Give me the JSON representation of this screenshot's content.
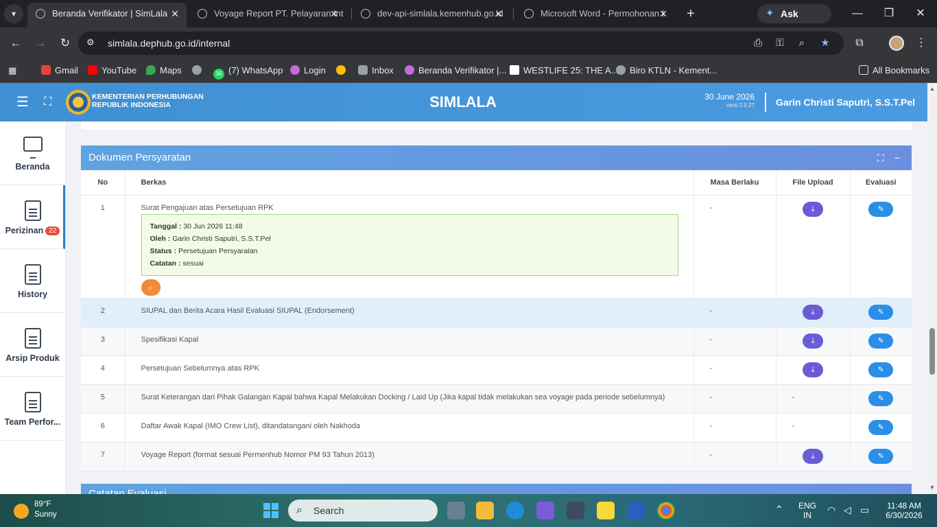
{
  "browser": {
    "tabs": [
      {
        "title": "Beranda Verifikator | SimLala",
        "active": true
      },
      {
        "title": "Voyage Report PT. Pelayaran Int",
        "active": false
      },
      {
        "title": "dev-api-simlala.kemenhub.go.id",
        "active": false
      },
      {
        "title": "Microsoft Word - Permohonan I",
        "active": false
      }
    ],
    "gemini_label": "Ask Gemini",
    "url": "simlala.dephub.go.id/internal",
    "bookmarks": [
      {
        "label": "Gmail",
        "color": "#ea4335"
      },
      {
        "label": "YouTube",
        "color": "#ff0000"
      },
      {
        "label": "Maps",
        "color": "#34a853"
      },
      {
        "label": "",
        "color": "#9aa0a6"
      },
      {
        "label": "(7) WhatsApp",
        "color": "#25d366"
      },
      {
        "label": "Login",
        "color": "#c26bd6"
      },
      {
        "label": "",
        "color": "#fbbc04"
      },
      {
        "label": "Inbox",
        "color": "#9aa0a6"
      },
      {
        "label": "Beranda Verifikator |...",
        "color": "#c26bd6"
      },
      {
        "label": "WESTLIFE 25: THE A...",
        "color": "#ffffff"
      },
      {
        "label": "Biro KTLN - Kement...",
        "color": "#9aa0a6"
      }
    ],
    "whatsapp_count": "36",
    "all_bookmarks": "All Bookmarks"
  },
  "header": {
    "org_line1": "KEMENTERIAN PERHUBUNGAN",
    "org_line2": "REPUBLIK INDONESIA",
    "app_name": "SIMLALA",
    "date": "30 June 2026",
    "version": "versi 2.0.27",
    "user": "Garin Christi Saputri, S.S.T.Pel"
  },
  "sidebar": {
    "items": [
      {
        "label": "Beranda"
      },
      {
        "label": "Perizinan",
        "badge": "22"
      },
      {
        "label": "History"
      },
      {
        "label": "Arsip Produk"
      },
      {
        "label": "Team Perfor..."
      }
    ]
  },
  "documents": {
    "title": "Dokumen Persyaratan",
    "columns": [
      "No",
      "Berkas",
      "Masa Berlaku",
      "File Upload",
      "Evaluasi"
    ],
    "rows": [
      {
        "no": "1",
        "berkas": "Surat Pengajuan atas Persetujuan RPK",
        "masa": "-",
        "has_upload": true
      },
      {
        "no": "2",
        "berkas": "SIUPAL dan Berita Acara Hasil Evaluasi SIUPAL (Endorsement)",
        "masa": "-",
        "has_upload": true
      },
      {
        "no": "3",
        "berkas": "Spesifikasi Kapal",
        "masa": "-",
        "has_upload": true
      },
      {
        "no": "4",
        "berkas": "Persetujuan Sebelumnya atas RPK",
        "masa": "-",
        "has_upload": true
      },
      {
        "no": "5",
        "berkas": "Surat Keterangan dari Pihak Galangan Kapal bahwa Kapal Melakukan Docking / Laid Up (Jika kapal tidak melakukan sea voyage pada periode sebelumnya)",
        "masa": "-",
        "has_upload": false,
        "upload_text": "-"
      },
      {
        "no": "6",
        "berkas": "Daftar Awak Kapal (IMO Crew List), ditandatangani oleh Nakhoda",
        "masa": "-",
        "has_upload": false,
        "upload_text": "-"
      },
      {
        "no": "7",
        "berkas": "Voyage Report (format sesuai Permenhub Nomor PM 93 Tahun 2013)",
        "masa": "-",
        "has_upload": true
      }
    ],
    "evaluation": {
      "tanggal_label": "Tanggal :",
      "tanggal": "30 Jun 2026 11:48",
      "oleh_label": "Oleh :",
      "oleh": "Garin Christi Saputri, S.S.T.Pel",
      "status_label": "Status :",
      "status": "Persetujuan Persyaratan",
      "catatan_label": "Catatan :",
      "catatan": "sesuai"
    }
  },
  "next_section_title": "Catatan Evaluasi",
  "taskbar": {
    "temp": "89°F",
    "condition": "Sunny",
    "search_placeholder": "Search",
    "lang1": "ENG",
    "lang2": "IN",
    "time": "11:48 AM",
    "date": "6/30/2026"
  }
}
